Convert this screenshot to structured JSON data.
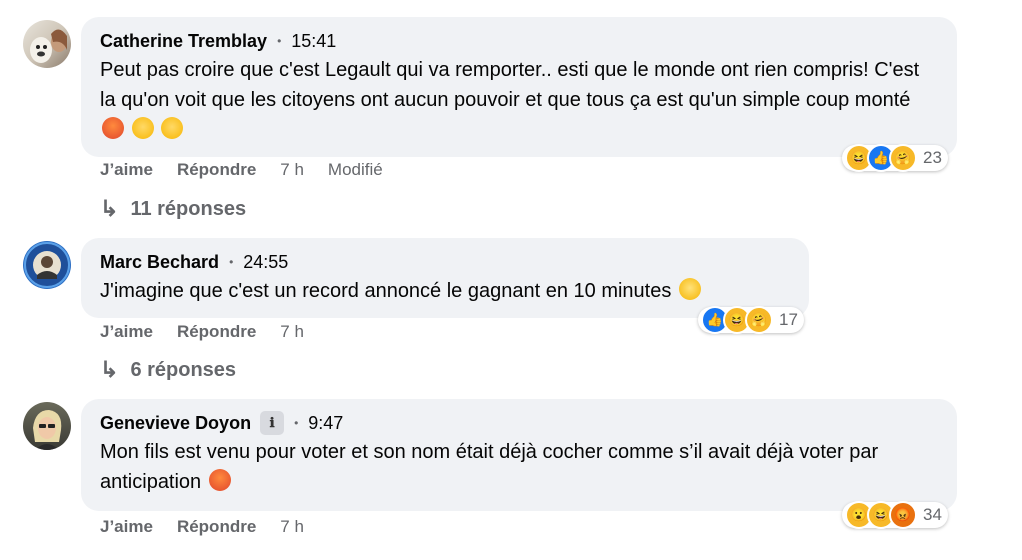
{
  "comments": [
    {
      "author": "Catherine Tremblay",
      "time": "15:41",
      "text": "Peut pas croire que c'est Legault qui va remporter.. esti que le monde ont rien compris! C'est la qu'on voit que les citoyens ont aucun pouvoir et que tous ça est qu'un simple coup monté",
      "emojis": [
        "angry-face-icon",
        "pensive-face-icon",
        "pensive-face-icon"
      ],
      "reactions": [
        "haha-icon",
        "like-icon",
        "care-icon"
      ],
      "reaction_count": "23",
      "like_label": "J’aime",
      "reply_label": "Répondre",
      "age": "7 h",
      "edited": "Modifié",
      "replies_label": "11 réponses"
    },
    {
      "author": "Marc Bechard",
      "time": "24:55",
      "text": "J'imagine que c'est un record annoncé le gagnant en 10 minutes",
      "emojis": [
        "tears-of-joy-icon"
      ],
      "reactions": [
        "like-icon",
        "haha-icon",
        "care-icon"
      ],
      "reaction_count": "17",
      "like_label": "J’aime",
      "reply_label": "Répondre",
      "age": "7 h",
      "replies_label": "6 réponses"
    },
    {
      "author": "Genevieve Doyon",
      "time": "9:47",
      "text": "Mon fils est venu pour voter et son nom était déjà cocher comme s’il avait déjà voter par anticipation",
      "emojis": [
        "angry-face-icon"
      ],
      "reactions": [
        "wow-icon",
        "haha-icon",
        "angry-icon"
      ],
      "reaction_count": "34",
      "like_label": "J’aime",
      "reply_label": "Répondre",
      "age": "7 h"
    }
  ],
  "colors": {
    "bubble": "#f0f2f5",
    "muted": "#65676b",
    "like_blue": "#1877f2"
  }
}
